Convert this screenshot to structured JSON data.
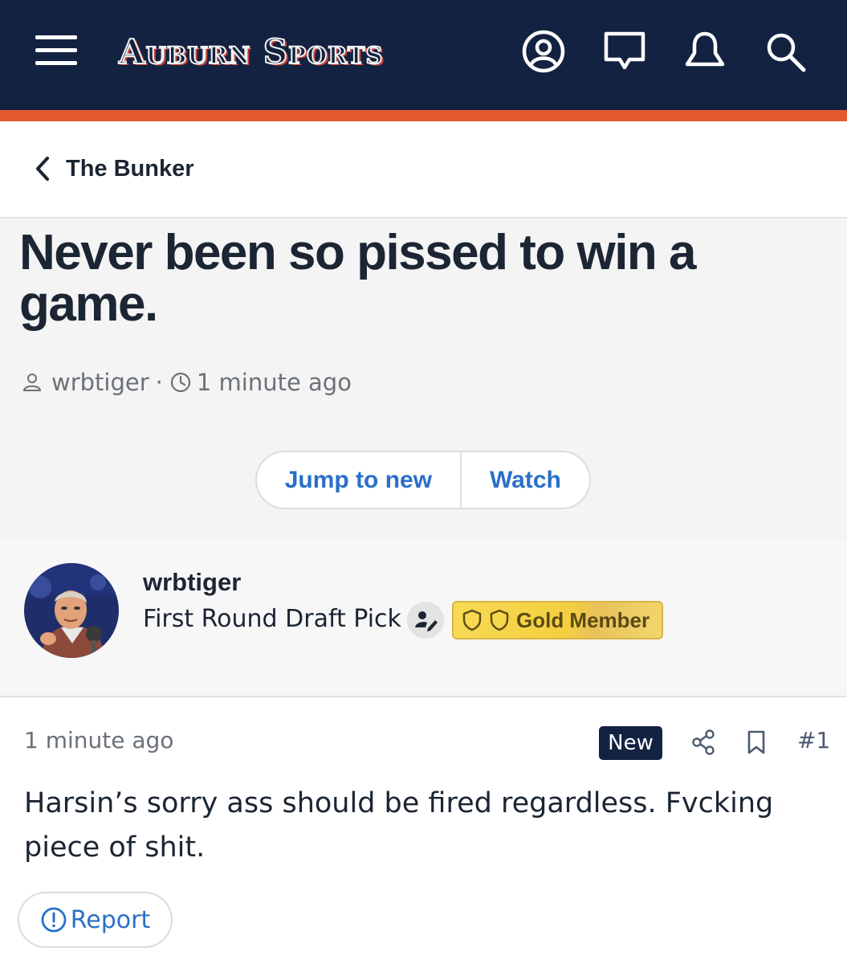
{
  "header": {
    "logo_text": "Auburn Sports",
    "bg_color": "#132241",
    "accent_color": "#e35a2e",
    "icons": [
      "menu-icon",
      "user-account-icon",
      "chat-icon",
      "bell-icon",
      "search-icon"
    ]
  },
  "breadcrumb": {
    "label": "The Bunker"
  },
  "thread": {
    "title": "Never been so pissed to win a game.",
    "author": "wrbtiger",
    "separator": "·",
    "time": "1 minute ago",
    "buttons": {
      "jump": "Jump to new",
      "watch": "Watch"
    }
  },
  "author_block": {
    "name": "wrbtiger",
    "rank": "First Round Draft Pick",
    "badge": "Gold Member"
  },
  "post": {
    "time": "1 minute ago",
    "new_label": "New",
    "number": "#1",
    "body": "Harsin’s sorry ass should be fired regardless. Fvcking piece of shit.",
    "report_label": "Report"
  }
}
